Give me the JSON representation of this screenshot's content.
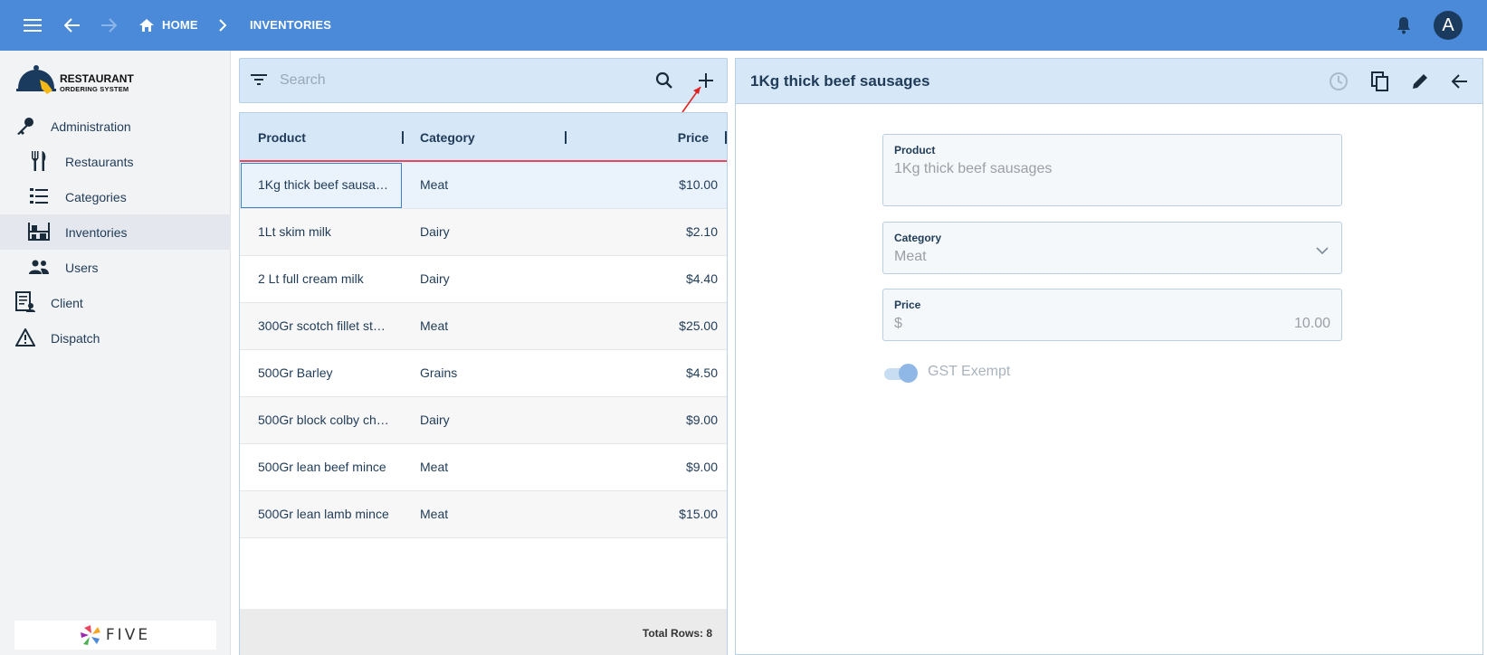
{
  "topbar": {
    "breadcrumb": [
      {
        "label": "HOME"
      },
      {
        "label": "INVENTORIES"
      }
    ],
    "avatar_initial": "A"
  },
  "sidebar": {
    "logo": {
      "line1": "RESTAURANT",
      "line2": "ORDERING SYSTEM"
    },
    "items": [
      {
        "label": "Administration",
        "icon": "key-icon"
      },
      {
        "label": "Restaurants",
        "icon": "fork-knife-icon"
      },
      {
        "label": "Categories",
        "icon": "list-icon"
      },
      {
        "label": "Inventories",
        "icon": "shelves-icon",
        "active": true
      },
      {
        "label": "Users",
        "icon": "users-icon"
      },
      {
        "label": "Client",
        "icon": "form-icon"
      },
      {
        "label": "Dispatch",
        "icon": "warning-triangle-icon"
      }
    ],
    "footer_logo": "FIVE"
  },
  "search": {
    "placeholder": "Search"
  },
  "list": {
    "columns": [
      "Product",
      "Category",
      "Price"
    ],
    "rows": [
      {
        "product": "1Kg thick beef sausa…",
        "category": "Meat",
        "price": "$10.00",
        "selected": true
      },
      {
        "product": "1Lt skim milk",
        "category": "Dairy",
        "price": "$2.10"
      },
      {
        "product": "2 Lt full cream milk",
        "category": "Dairy",
        "price": "$4.40"
      },
      {
        "product": "300Gr scotch fillet st…",
        "category": "Meat",
        "price": "$25.00"
      },
      {
        "product": "500Gr Barley",
        "category": "Grains",
        "price": "$4.50"
      },
      {
        "product": "500Gr block colby ch…",
        "category": "Dairy",
        "price": "$9.00"
      },
      {
        "product": "500Gr lean beef mince",
        "category": "Meat",
        "price": "$9.00"
      },
      {
        "product": "500Gr lean lamb mince",
        "category": "Meat",
        "price": "$15.00"
      }
    ],
    "total_rows": "Total Rows: 8"
  },
  "detail": {
    "title": "1Kg thick beef sausages",
    "fields": {
      "product": {
        "label": "Product",
        "value": "1Kg thick beef sausages"
      },
      "category": {
        "label": "Category",
        "value": "Meat"
      },
      "price": {
        "label": "Price",
        "currency": "$",
        "value": "10.00"
      }
    },
    "gst_exempt": {
      "label": "GST Exempt",
      "on": true
    }
  },
  "colors": {
    "topbar": "#4a8ad8",
    "panel_header": "#d6e7f8",
    "accent_line": "#e8475f",
    "text": "#1f3b57"
  }
}
